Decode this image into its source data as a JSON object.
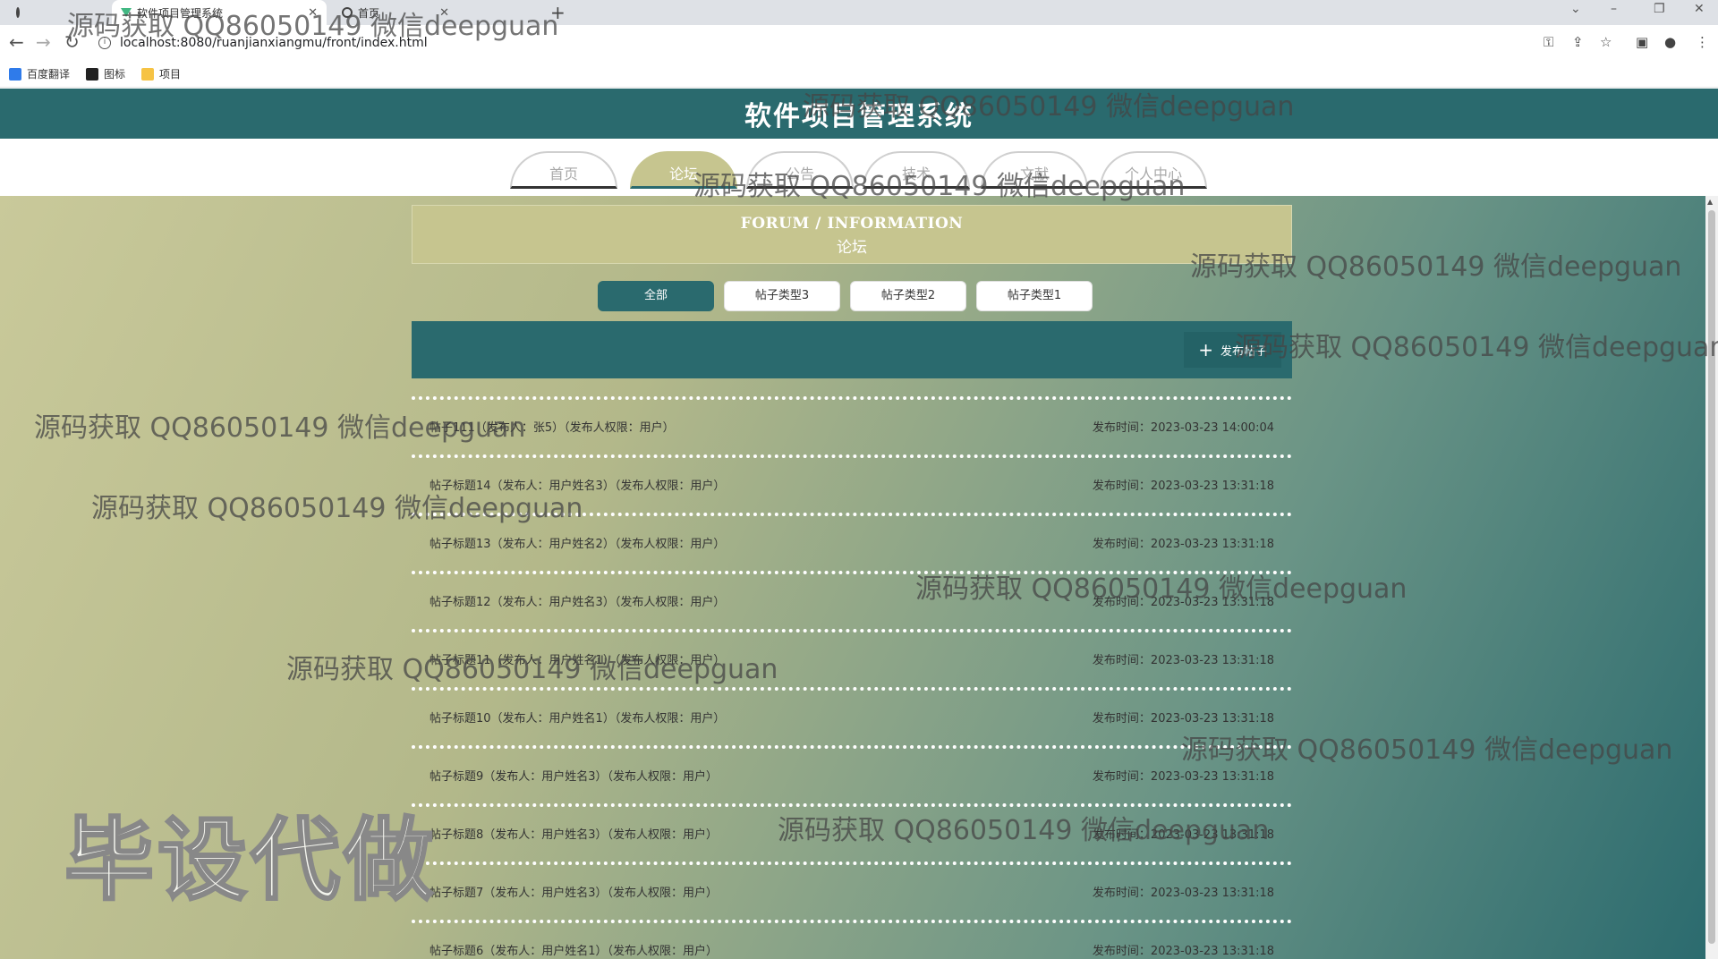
{
  "browser": {
    "tabs": [
      {
        "label": ""
      },
      {
        "label": "软件项目管理系统"
      },
      {
        "label": "首页"
      }
    ],
    "url": "localhost:8080/ruanjianxiangmu/front/index.html",
    "bookmarks": [
      {
        "label": "百度翻译",
        "icon": "translate-icon"
      },
      {
        "label": "图标",
        "icon": "image-icon"
      },
      {
        "label": "项目",
        "icon": "folder-icon"
      }
    ]
  },
  "header": {
    "title": "软件项目管理系统"
  },
  "nav": [
    {
      "label": "首页"
    },
    {
      "label": "论坛"
    },
    {
      "label": "公告"
    },
    {
      "label": "技术"
    },
    {
      "label": "文献"
    },
    {
      "label": "个人中心"
    }
  ],
  "section": {
    "title_en": "FORUM / INFORMATION",
    "title_cn": "论坛"
  },
  "filters": [
    {
      "label": "全部"
    },
    {
      "label": "帖子类型3"
    },
    {
      "label": "帖子类型2"
    },
    {
      "label": "帖子类型1"
    }
  ],
  "add_button": {
    "label": "发布帖子"
  },
  "posts": [
    {
      "title": "帖子111（发布人：张5）（发布人权限：用户）",
      "time": "发布时间：2023-03-23 14:00:04"
    },
    {
      "title": "帖子标题14（发布人：用户姓名3）（发布人权限：用户）",
      "time": "发布时间：2023-03-23 13:31:18"
    },
    {
      "title": "帖子标题13（发布人：用户姓名2）（发布人权限：用户）",
      "time": "发布时间：2023-03-23 13:31:18"
    },
    {
      "title": "帖子标题12（发布人：用户姓名3）（发布人权限：用户）",
      "time": "发布时间：2023-03-23 13:31:18"
    },
    {
      "title": "帖子标题11（发布人：用户姓名1）（发布人权限：用户）",
      "time": "发布时间：2023-03-23 13:31:18"
    },
    {
      "title": "帖子标题10（发布人：用户姓名1）（发布人权限：用户）",
      "time": "发布时间：2023-03-23 13:31:18"
    },
    {
      "title": "帖子标题9（发布人：用户姓名3）（发布人权限：用户）",
      "time": "发布时间：2023-03-23 13:31:18"
    },
    {
      "title": "帖子标题8（发布人：用户姓名3）（发布人权限：用户）",
      "time": "发布时间：2023-03-23 13:31:18"
    },
    {
      "title": "帖子标题7（发布人：用户姓名3）（发布人权限：用户）",
      "time": "发布时间：2023-03-23 13:31:18"
    },
    {
      "title": "帖子标题6（发布人：用户姓名1）（发布人权限：用户）",
      "time": "发布时间：2023-03-23 13:31:18"
    }
  ],
  "watermark": {
    "text": "源码获取 QQ86050149 微信deepguan",
    "big_text": "毕设代做"
  },
  "colors": {
    "header": "#2a6a6e",
    "accent": "#c6c58f",
    "filter_active": "#2a6a6e"
  }
}
